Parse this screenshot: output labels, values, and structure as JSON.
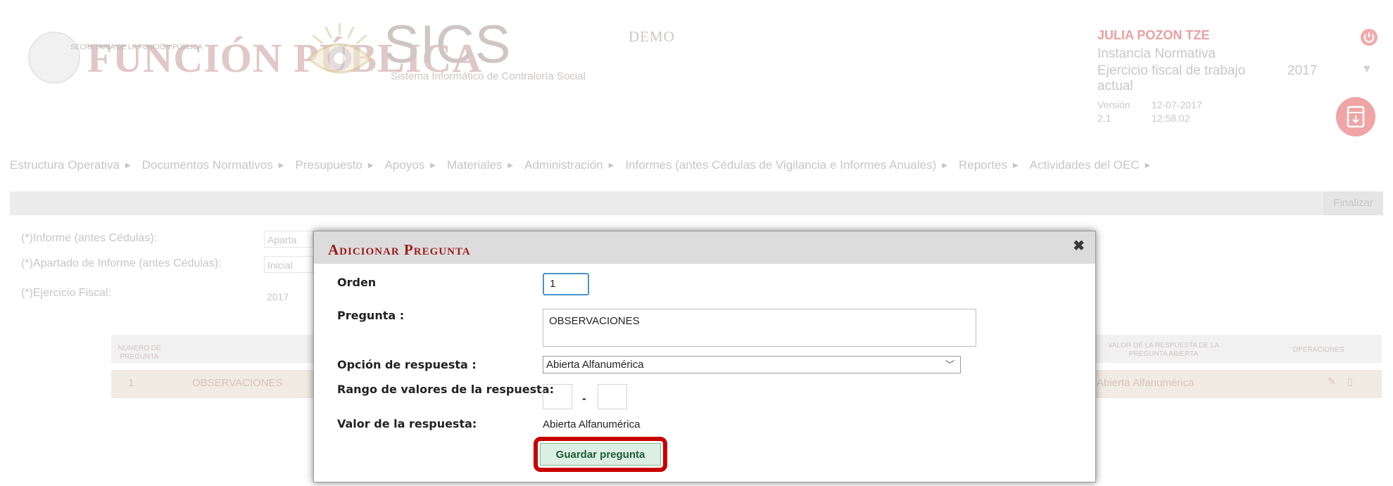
{
  "header": {
    "logo_title": "FUNCIÓN PÚBLICA",
    "logo_subtitle": "SECRETARÍA DE LA FUNCIÓN PÚBLICA",
    "app_name": "SICS",
    "app_subtitle": "Sistema Informático de Contraloría Social",
    "env_label": "DEMO",
    "user_name": "JULIA POZON TZE",
    "role": "Instancia Normativa",
    "fiscal_label": "Ejercicio fiscal de trabajo actual",
    "fiscal_year": "2017",
    "version_label": "Versión 2.1",
    "version_date": "12-07-2017 12:58:02"
  },
  "menu": {
    "items": [
      "Estructura Operativa",
      "Documentos Normativos",
      "Presupuesto",
      "Apoyos",
      "Materiales",
      "Administración",
      "Informes (antes Cédulas de Vigilancia e Informes Anuales)",
      "Reportes",
      "Actividades del OEC"
    ]
  },
  "toolbar": {
    "finalizar_label": "Finalizar"
  },
  "form": {
    "informe_label": "(*)Informe (antes Cédulas):",
    "informe_value": "Aparta",
    "apartado_label": "(*)Apartado de Informe (antes Cédulas):",
    "apartado_value": "Inicial",
    "ejercicio_label": "(*)Ejercicio Fiscal:",
    "ejercicio_value": "2017"
  },
  "table": {
    "headers": [
      "NÚMERO DE PREGUNTA",
      "VALOR DE LA RESPUESTA DE LA PREGUNTA ABIERTA",
      "OPERACIONES"
    ],
    "row": {
      "numero": "1",
      "pregunta": "OBSERVACIONES",
      "valor": "Abierta Alfanumérica"
    }
  },
  "modal": {
    "title": "Adicionar Pregunta",
    "orden_label": "Orden",
    "orden_value": "1",
    "pregunta_label": "Pregunta :",
    "pregunta_value": "OBSERVACIONES",
    "opcion_label": "Opción de respuesta :",
    "opcion_value": "Abierta Alfanumérica",
    "rango_label": "Rango de valores de la respuesta:",
    "rango_dash": "-",
    "valor_label": "Valor de la respuesta:",
    "valor_value": "Abierta Alfanumérica",
    "save_label": "Guardar pregunta"
  },
  "colors": {
    "brand_red": "#9b1c1c",
    "highlight_red": "#c80000",
    "save_green": "#dcefe3"
  },
  "icons": {
    "close": "close-icon",
    "power": "power-icon",
    "download": "download-icon",
    "select": "chevron-down-icon"
  }
}
